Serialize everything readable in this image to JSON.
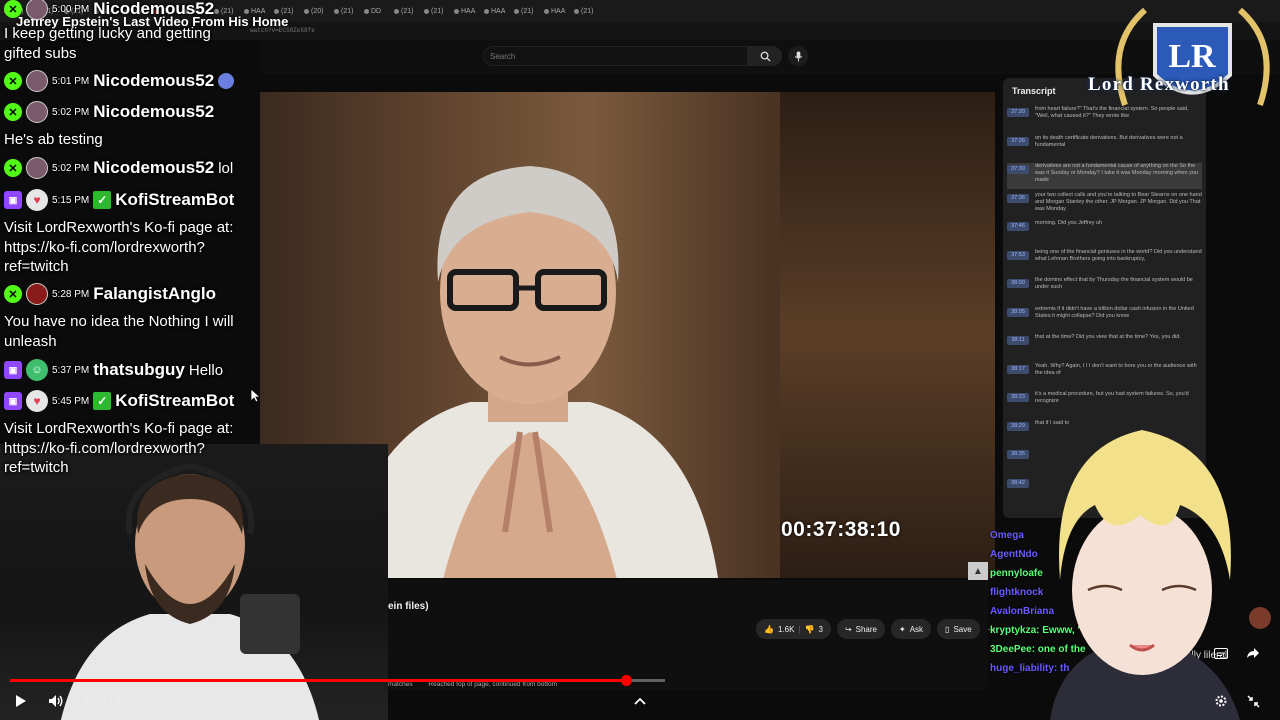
{
  "browser": {
    "tabs": [
      "(27)",
      "(21)",
      "(21)",
      "Jay",
      "Jay",
      "(Bj",
      "HAA",
      "(21)",
      "HAA",
      "(21)",
      "(20)",
      "(21)",
      "DD",
      "(21)",
      "(21)",
      "HAA",
      "HAA",
      "(21)",
      "HAA",
      "(21)"
    ],
    "url": "watch?v=ECS0ZeX8fe"
  },
  "youtube": {
    "search_placeholder": "Search",
    "title_fragment": "ein files)",
    "likes": "1.6K",
    "dislike_count": "3",
    "share_label": "Share",
    "ask_label": "Ask",
    "save_label": "Save",
    "find_matches": "matches",
    "find_status": "Reached top of page, continued from bottom"
  },
  "video": {
    "timecode": "00:37:38:10"
  },
  "transcript": {
    "title": "Transcript",
    "lines": [
      {
        "ts": "37:20",
        "text": "from heart failure?\" That's the financial system. So people said, \"Well, what caused it?\" They wrote like"
      },
      {
        "ts": "37:26",
        "text": "on its death certificate derivatives. But derivatives were not a fundamental"
      },
      {
        "ts": "37:30",
        "text": "derivatives are not a fundamental cause of anything on the So the was it Sunday or Monday? I take it was Monday morning when you made"
      },
      {
        "ts": "37:36",
        "text": "your two collect calls and you're talking to Bear Stearns on one hand and Morgan Stanley the other. JP Morgan. JP Morgan. Did you That was Monday"
      },
      {
        "ts": "37:46",
        "text": "morning. Did you Jeffrey uh"
      },
      {
        "ts": "37:53",
        "text": "being one of the financial geniuses in the world? Did you understand what Lehman Brothers going into bankruptcy,"
      },
      {
        "ts": "38:00",
        "text": "the domino effect that by Thursday the financial system would be under such"
      },
      {
        "ts": "38:05",
        "text": "extremis if it didn't have a trillion dollar cash infusion in the United States it might collapse? Did you know"
      },
      {
        "ts": "38:11",
        "text": "that at the time? Did you view that at the time? Yes, you did."
      },
      {
        "ts": "38:17",
        "text": "Yeah. Why? Again, I I I don't want to bore you or the audience with the idea of"
      },
      {
        "ts": "38:23",
        "text": "it's a medical procedure, but you had system failures. So, you'd recognize"
      },
      {
        "ts": "38:29",
        "text": "that if I said to"
      },
      {
        "ts": "38:35",
        "text": ""
      },
      {
        "ts": "38:42",
        "text": ""
      }
    ]
  },
  "stream_overlay": {
    "headline": "Jeffrey Epstein's Last Video From His Home",
    "chat": [
      {
        "time": "5:00 PM",
        "user": "Nicodemous52",
        "msg": "I keep getting lucky and getting gifted subs"
      },
      {
        "time": "5:01 PM",
        "user": "Nicodemous52",
        "msg": ""
      },
      {
        "time": "5:02 PM",
        "user": "Nicodemous52",
        "msg": "He's ab testing"
      },
      {
        "time": "5:02 PM",
        "user": "Nicodemous52",
        "msg": "lol"
      },
      {
        "time": "5:15 PM",
        "user": "KofiStreamBot",
        "msg": "Visit LordRexworth's Ko-fi page at: https://ko-fi.com/lordrexworth? ref=twitch"
      },
      {
        "time": "5:28 PM",
        "user": "FalangistAnglo",
        "msg": "You have no idea the Nothing I will unleash"
      },
      {
        "time": "5:37 PM",
        "user": "thatsubguy",
        "msg": "Hello"
      },
      {
        "time": "5:45 PM",
        "user": "KofiStreamBot",
        "msg": "Visit LordRexworth's Ko-fi page at: https://ko-fi.com/lordrexworth? ref=twitch"
      }
    ],
    "chat_lines": {
      "first_a": "I keep getting lucky and getting",
      "first_b": "gifted subs",
      "kofi_a": "Visit LordRexworth's Ko-fi page at:",
      "kofi_b": "https://ko-fi.com/lordrexworth?",
      "kofi_c": "ref=twitch",
      "falang_a": "You have no idea the Nothing I will",
      "falang_b": "unleash"
    },
    "logo_text": "Lord Rexworth",
    "logo_monogram": "LR",
    "side_chat": [
      {
        "text": "Omega",
        "color": "#6b5bff"
      },
      {
        "text": "AgentNdo",
        "color": "#6b5bff"
      },
      {
        "text": "pennyloafe",
        "color": "#5cff7a"
      },
      {
        "text": "flightknock",
        "color": "#6b5bff"
      },
      {
        "text": "AvalonBriana",
        "color": "#6b5bff"
      },
      {
        "text": "kryptykza: Ewww, \"J",
        "color": "#5cff7a"
      },
      {
        "text": "3DeePee: one of the",
        "color": "#5cff7a"
      },
      {
        "text": "huge_liability: th",
        "color": "#6b5bff"
      }
    ],
    "side_chat_extra": "ally lileral"
  },
  "player": {
    "time": "25:53 / 53:48",
    "progress": 0.9404
  }
}
